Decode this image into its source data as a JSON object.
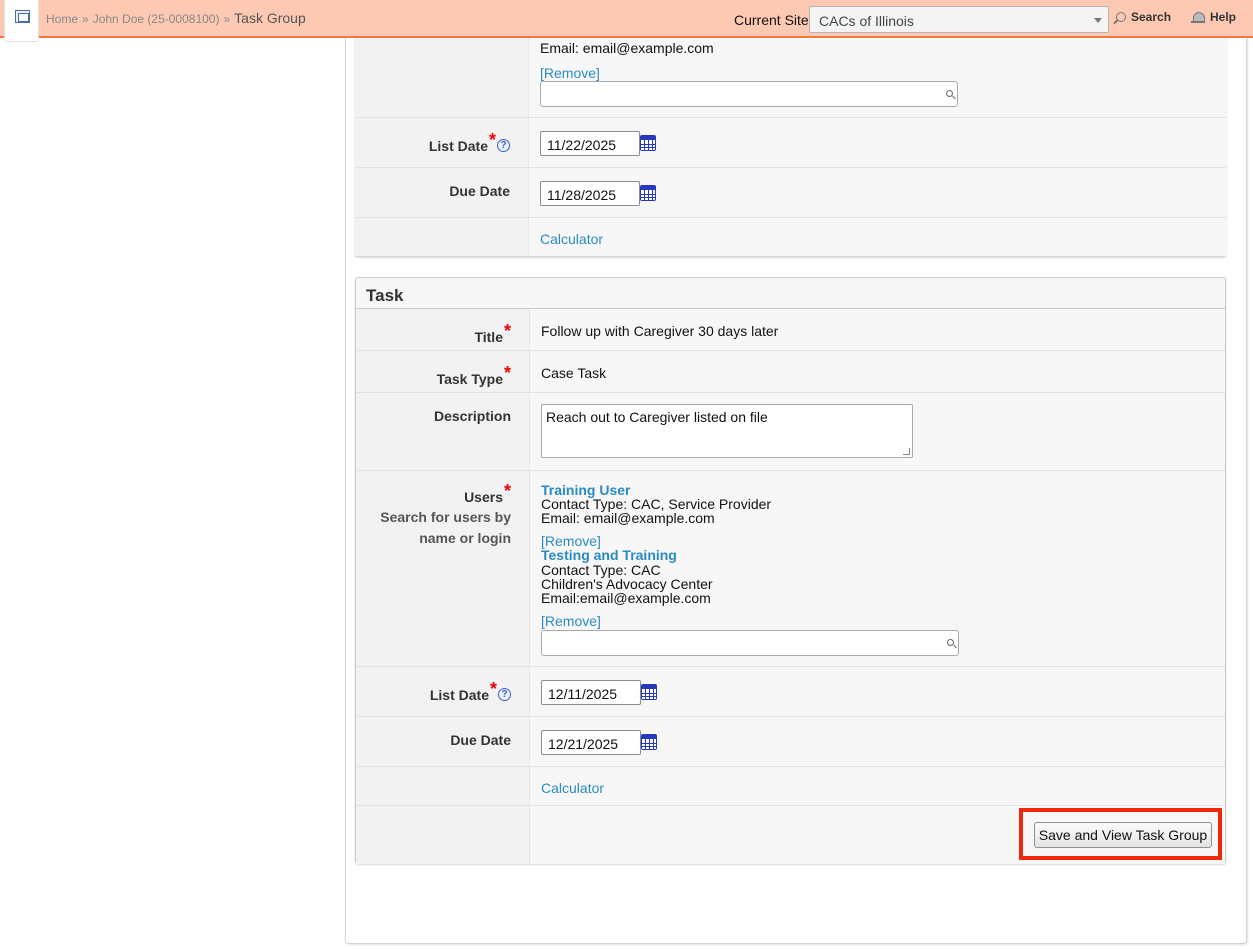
{
  "topbar": {
    "breadcrumb": {
      "home": "Home",
      "sep1": "»",
      "case": "John Doe (25-0008100)",
      "sep2": "»",
      "current": "Task Group"
    },
    "site_label": "Current Site",
    "site_value": "CACs of Illinois",
    "search_label": "Search",
    "help_label": "Help"
  },
  "prev_task": {
    "email": "Email: email@example.com",
    "remove": "[Remove]",
    "list_date_label": "List Date",
    "list_date_required": "*",
    "list_date_help": "?",
    "list_date": "11/22/2025",
    "due_date_label": "Due Date",
    "due_date": "11/28/2025",
    "calculator": "Calculator"
  },
  "task": {
    "header": "Task",
    "title_label": "Title",
    "title_required": "*",
    "title": "Follow up with Caregiver 30 days later",
    "type_label": "Task Type",
    "type_required": "*",
    "type": "Case Task",
    "description_label": "Description",
    "description": "Reach out to Caregiver listed on file",
    "users_label": "Users",
    "users_required": "*",
    "users_hint_1": "Search for users by",
    "users_hint_2": "name or login",
    "users": [
      {
        "name": "Training User",
        "contact_type": "Contact Type: CAC, Service Provider",
        "email": "Email: email@example.com",
        "remove": "[Remove]"
      },
      {
        "name": "Testing and Training",
        "contact_type": "Contact Type: CAC",
        "org": "Children's Advocacy Center",
        "email": "Email:email@example.com",
        "remove": "[Remove]"
      }
    ],
    "list_date_label": "List Date",
    "list_date_required": "*",
    "list_date_help": "?",
    "list_date": "12/11/2025",
    "due_date_label": "Due Date",
    "due_date": "12/21/2025",
    "calculator": "Calculator",
    "save_button": "Save and View Task Group"
  },
  "colors": {
    "topbar": "#fdc9b3",
    "topbar_border": "#f07a3c",
    "link": "#2a8bc4",
    "required": "#ee0000",
    "highlight": "#ee2a0a"
  }
}
